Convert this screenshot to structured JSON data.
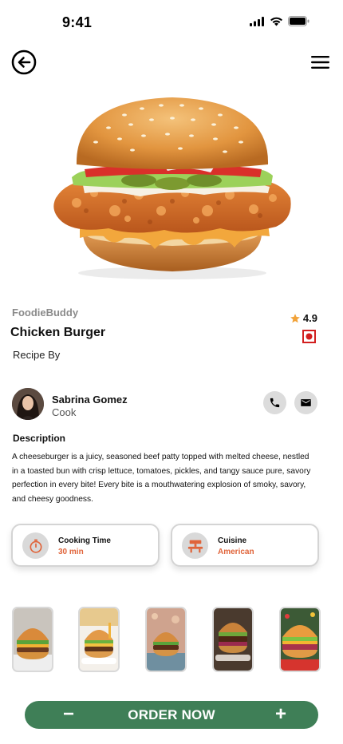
{
  "status_bar": {
    "time": "9:41",
    "icons": [
      "signal-icon",
      "wifi-icon",
      "battery-icon"
    ]
  },
  "nav": {
    "back_icon": "back-arrow-icon",
    "menu_icon": "hamburger-menu-icon"
  },
  "product": {
    "brand": "FoodieBuddy",
    "name": "Chicken Burger",
    "recipe_by": "Recipe By",
    "rating": "4.9",
    "rating_icon": "star-icon",
    "diet_icon": "non-veg-icon"
  },
  "chef": {
    "name": "Sabrina Gomez",
    "role": "Cook",
    "call_icon": "phone-icon",
    "mail_icon": "mail-icon"
  },
  "description": {
    "title": "Description",
    "body": "A cheeseburger is a juicy, seasoned beef patty topped with melted cheese, nestled in a toasted bun with crisp lettuce, tomatoes, pickles, and tangy sauce pure, savory perfection in every bite! Every bite is a mouthwatering explosion of smoky, savory, and cheesy goodness."
  },
  "cards": [
    {
      "label": "Cooking Time",
      "value": "30 min",
      "icon": "timer-icon"
    },
    {
      "label": "Cuisine",
      "value": "American",
      "icon": "cuisine-icon"
    }
  ],
  "gallery_count": 5,
  "order": {
    "minus": "−",
    "label": "ORDER NOW",
    "plus": "+"
  },
  "colors": {
    "accent_green": "#3f7f57",
    "highlight_orange": "#e0643a",
    "star": "#f2a33a",
    "nonveg_red": "#d21f1f"
  }
}
